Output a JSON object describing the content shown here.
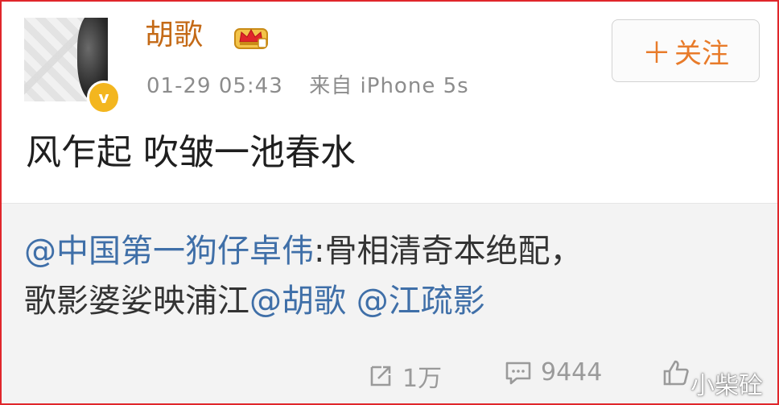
{
  "post": {
    "username": "胡歌",
    "timestamp": "01-29 05:43",
    "source": "来自 iPhone 5s",
    "follow_label": "关注",
    "text": "风乍起 吹皱一池春水"
  },
  "repost": {
    "segments": [
      {
        "text": "@中国第一狗仔卓伟",
        "mention": true
      },
      {
        "text": ":骨相清奇本绝配，",
        "mention": false
      },
      {
        "text": "歌影婆娑映浦江",
        "mention": false
      },
      {
        "text": "@胡歌",
        "mention": true
      },
      {
        "text": " ",
        "mention": false
      },
      {
        "text": "@江疏影",
        "mention": true
      }
    ]
  },
  "actions": {
    "forward_count": "1万",
    "comment_count": "9444"
  },
  "watermark": "小柴砼",
  "colors": {
    "border": "#e0262b",
    "username": "#c46a17",
    "mention": "#3f6fa8",
    "follow": "#e87b2a",
    "verified": "#f3b61f"
  },
  "icons": [
    "verified-v-icon",
    "vip-crown-icon",
    "plus-icon",
    "forward-icon",
    "comment-icon",
    "like-icon"
  ]
}
